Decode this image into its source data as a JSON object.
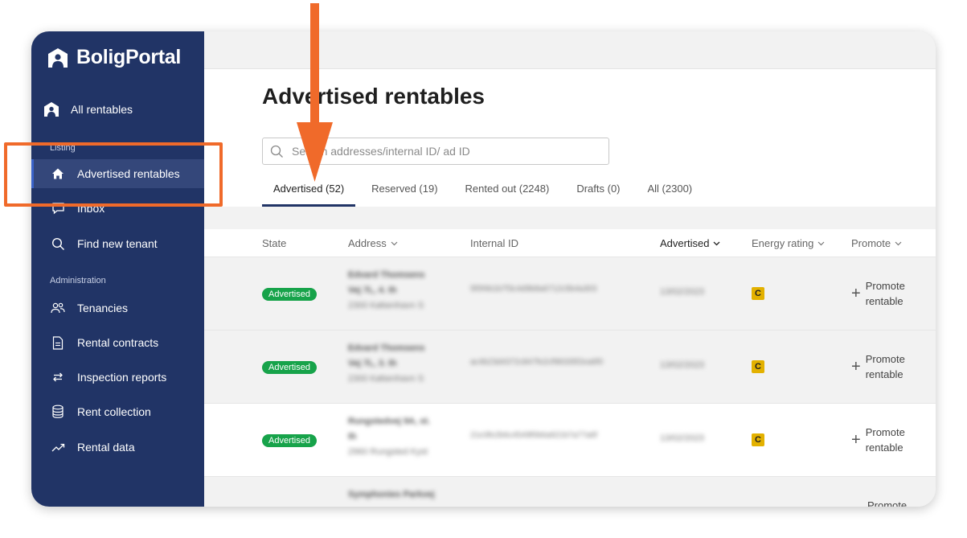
{
  "brand": {
    "name": "BoligPortal"
  },
  "sidebar": {
    "top_item": {
      "label": "All rentables",
      "icon": "house-person-icon"
    },
    "section_listing": "Listing",
    "listing_items": [
      {
        "label": "Advertised rentables",
        "icon": "home-icon",
        "active": true
      },
      {
        "label": "Inbox",
        "icon": "chat-icon"
      },
      {
        "label": "Find new tenant",
        "icon": "search-icon"
      }
    ],
    "section_admin": "Administration",
    "admin_items": [
      {
        "label": "Tenancies",
        "icon": "people-icon"
      },
      {
        "label": "Rental contracts",
        "icon": "document-icon"
      },
      {
        "label": "Inspection reports",
        "icon": "swap-arrows-icon"
      },
      {
        "label": "Rent collection",
        "icon": "coins-icon"
      },
      {
        "label": "Rental data",
        "icon": "trend-icon"
      }
    ]
  },
  "main": {
    "title": "Advertised rentables",
    "search": {
      "placeholder": "Search addresses/internal ID/ ad ID",
      "value": ""
    },
    "tabs": [
      {
        "label": "Advertised (52)",
        "active": true
      },
      {
        "label": "Reserved (19)"
      },
      {
        "label": "Rented out (2248)"
      },
      {
        "label": "Drafts (0)"
      },
      {
        "label": "All (2300)"
      }
    ],
    "columns": {
      "state": "State",
      "address": "Address",
      "internal_id": "Internal ID",
      "advertised": "Advertised",
      "energy": "Energy rating",
      "promote": "Promote"
    },
    "rows": [
      {
        "state": "Advertised",
        "address_line1": "Edvard Thomsens",
        "address_line2": "Vej 7L, 4. th",
        "address_line3": "2300 København S",
        "internal_id": "5f0f4b1b7f3c4d9b8a6712c5b4a303",
        "advertised": "13/02/2023",
        "energy": "C",
        "promote": "Promote rentable"
      },
      {
        "state": "Advertised",
        "address_line1": "Edvard Thomsens",
        "address_line2": "Vej 7L, 3. th",
        "address_line3": "2300 København S",
        "internal_id": "ac4b23d4372c847fe2cf98335f2ea6f0",
        "advertised": "13/02/2023",
        "energy": "C",
        "promote": "Promote rentable"
      },
      {
        "state": "Advertised",
        "address_line1": "Rungstedvej 9A, st.",
        "address_line2": "th",
        "address_line3": "2960 Rungsted Kyst",
        "internal_id": "21e3fe2b6c4549f0b6a921b7a77a6f",
        "advertised": "13/02/2023",
        "energy": "C",
        "promote": "Promote rentable"
      },
      {
        "state": "",
        "address_line1": "Symphonies Parkvej",
        "address_line2": "",
        "address_line3": "",
        "internal_id": "",
        "advertised": "",
        "energy": "",
        "promote": "Promote"
      }
    ]
  },
  "colors": {
    "sidebar": "#213466",
    "badge": "#17a34a",
    "energy_c": "#e3b100",
    "annotation": "#f06a2a"
  }
}
